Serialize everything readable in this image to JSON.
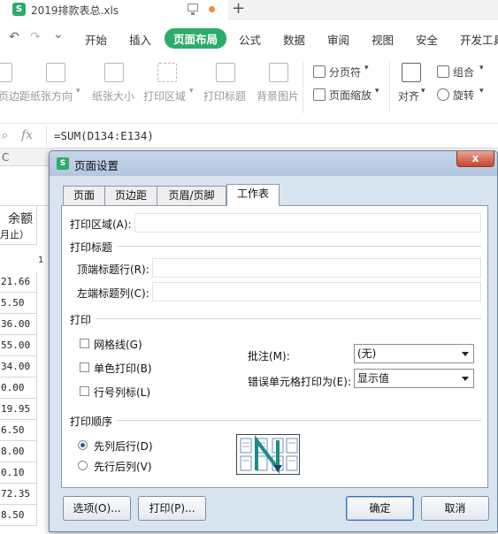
{
  "window": {
    "doc_icon": "S",
    "doc_title": "2019排款表总.xls",
    "new_tab": "+"
  },
  "menu": {
    "undo": "↶",
    "redo": "↷",
    "more": "⌄",
    "items": [
      "开始",
      "插入",
      "页面布局",
      "公式",
      "数据",
      "审阅",
      "视图",
      "安全",
      "开发工具"
    ],
    "active_index": 2
  },
  "ribbon": {
    "items": [
      "页边距",
      "纸张方向",
      "纸张大小",
      "打印区域",
      "打印标题",
      "背景图片"
    ],
    "page_break": "分页符",
    "page_zoom": "页面缩放",
    "align": "对齐",
    "group": "组合",
    "rotate": "旋转"
  },
  "formula": {
    "fx": "fx",
    "value": "=SUM(D134:E134)"
  },
  "sheet": {
    "col_label": "C",
    "header": "余额",
    "header_sub": "月止）",
    "next_col": "1",
    "values": [
      "21.66",
      "5.50",
      "36.00",
      "55.00",
      "34.00",
      "0.00",
      "19.95",
      "6.50",
      "8.00",
      "0.10",
      "72.35",
      "8.50"
    ]
  },
  "dialog": {
    "icon": "S",
    "title": "页面设置",
    "close": "x",
    "tabs": [
      "页面",
      "页边距",
      "页眉/页脚",
      "工作表"
    ],
    "active_tab": 3,
    "print_area_label": "打印区域(A):",
    "print_area_value": "",
    "print_titles_label": "打印标题",
    "title_rows_label": "顶端标题行(R):",
    "title_rows_value": "",
    "title_cols_label": "左端标题列(C):",
    "title_cols_value": "",
    "print_label": "打印",
    "gridlines_label": "网格线(G)",
    "gridlines_checked": false,
    "mono_label": "单色打印(B)",
    "mono_checked": false,
    "rowcol_label": "行号列标(L)",
    "rowcol_checked": false,
    "comments_label": "批注(M):",
    "comments_value": "(无)",
    "errors_label": "错误单元格打印为(E):",
    "errors_value": "显示值",
    "order_label": "打印顺序",
    "down_then_over": "先列后行(D)",
    "over_then_down": "先行后列(V)",
    "order_selected": "down_then_over",
    "options_btn": "选项(O)...",
    "print_btn": "打印(P)...",
    "ok_btn": "确定",
    "cancel_btn": "取消"
  },
  "colors": {
    "accent": "#2dab6a",
    "dialog_bg": "#d9e4f1",
    "close_red": "#c7452c"
  }
}
